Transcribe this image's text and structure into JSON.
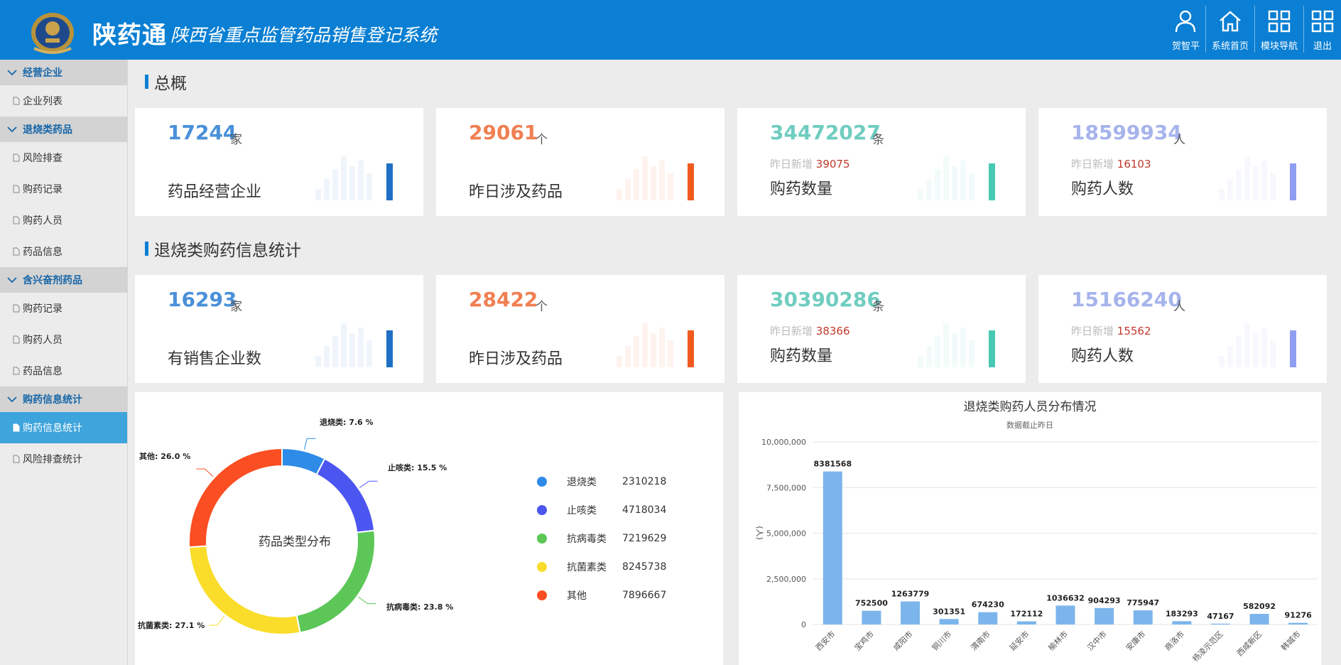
{
  "header": {
    "brand": "陕药通",
    "subtitle": "陕西省重点监管药品销售登记系统",
    "nav": [
      {
        "label": "贺智平",
        "icon": "user-icon"
      },
      {
        "label": "系统首页",
        "icon": "home-icon"
      },
      {
        "label": "模块导航",
        "icon": "grid-icon"
      },
      {
        "label": "退出",
        "icon": "exit-grid-icon"
      }
    ]
  },
  "sidebar": {
    "groups": [
      {
        "label": "经营企业",
        "items": [
          "企业列表"
        ]
      },
      {
        "label": "退烧类药品",
        "items": [
          "风险排查",
          "购药记录",
          "购药人员",
          "药品信息"
        ]
      },
      {
        "label": "含兴奋剂药品",
        "items": [
          "购药记录",
          "购药人员",
          "药品信息"
        ]
      },
      {
        "label": "购药信息统计",
        "items": [
          "购药信息统计",
          "风险排查统计"
        ]
      }
    ],
    "active_item": "购药信息统计"
  },
  "overview": {
    "title": "总概",
    "cards": [
      {
        "value": "17244",
        "unit": "家",
        "label": "药品经营企业",
        "sub_label": "",
        "sub_value": "",
        "color": "#4a90d9",
        "accent": "#1f6fc5"
      },
      {
        "value": "29061",
        "unit": "个",
        "label": "昨日涉及药品",
        "sub_label": "",
        "sub_value": "",
        "color": "#f07f52",
        "accent": "#f05a1e"
      },
      {
        "value": "34472027",
        "unit": "条",
        "label": "购药数量",
        "sub_label": "昨日新增",
        "sub_value": "39075",
        "color": "#6fcdc0",
        "accent": "#47c9b6"
      },
      {
        "value": "18599934",
        "unit": "人",
        "label": "购药人数",
        "sub_label": "昨日新增",
        "sub_value": "16103",
        "color": "#a6b4ec",
        "accent": "#8f9df0"
      }
    ]
  },
  "fever": {
    "title": "退烧类购药信息统计",
    "cards": [
      {
        "value": "16293",
        "unit": "家",
        "label": "有销售企业数",
        "sub_label": "",
        "sub_value": "",
        "color": "#4a90d9",
        "accent": "#1f6fc5"
      },
      {
        "value": "28422",
        "unit": "个",
        "label": "昨日涉及药品",
        "sub_label": "",
        "sub_value": "",
        "color": "#f07f52",
        "accent": "#f05a1e"
      },
      {
        "value": "30390286",
        "unit": "条",
        "label": "购药数量",
        "sub_label": "昨日新增",
        "sub_value": "38366",
        "color": "#6fcdc0",
        "accent": "#47c9b6"
      },
      {
        "value": "15166240",
        "unit": "人",
        "label": "购药人数",
        "sub_label": "昨日新增",
        "sub_value": "15562",
        "color": "#a6b4ec",
        "accent": "#8f9df0"
      }
    ]
  },
  "chart_data": [
    {
      "type": "pie",
      "title": "药品类型分布",
      "categories": [
        "退烧类",
        "止咳类",
        "抗病毒类",
        "抗菌素类",
        "其他"
      ],
      "values": [
        2310218,
        4718034,
        7219629,
        8245738,
        7896667
      ],
      "percent_labels": [
        "退烧类: 7.6 %",
        "止咳类: 15.5 %",
        "抗病毒类: 23.8 %",
        "抗菌素类: 27.1 %",
        "其他: 26.0 %"
      ],
      "colors": [
        "#2e8be8",
        "#4b55f0",
        "#5cc757",
        "#fadd2b",
        "#fb4e22"
      ],
      "legend_placement": "right"
    },
    {
      "type": "bar",
      "title": "退烧类购药人员分布情况",
      "subtitle": "数据截止昨日",
      "ylabel": "(人)",
      "categories": [
        "西安市",
        "宝鸡市",
        "咸阳市",
        "铜川市",
        "渭南市",
        "延安市",
        "榆林市",
        "汉中市",
        "安康市",
        "商洛市",
        "杨凌示范区",
        "西咸新区",
        "韩城市"
      ],
      "values": [
        8381568,
        752500,
        1263779,
        301351,
        674230,
        172112,
        1036632,
        904293,
        775947,
        183293,
        47167,
        582092,
        91276
      ],
      "value_labels": [
        "8381568",
        "752500",
        "1263779",
        "301351",
        "674230",
        "172112",
        "1036632",
        "904293",
        "775947",
        "183293",
        "47167",
        "582092",
        "91276"
      ],
      "y_ticks": [
        "0",
        "2,500,000",
        "5,000,000",
        "7,500,000",
        "10,000,000"
      ],
      "ylim": [
        0,
        10000000
      ],
      "color": "#7cb5ec",
      "grid": true
    }
  ]
}
